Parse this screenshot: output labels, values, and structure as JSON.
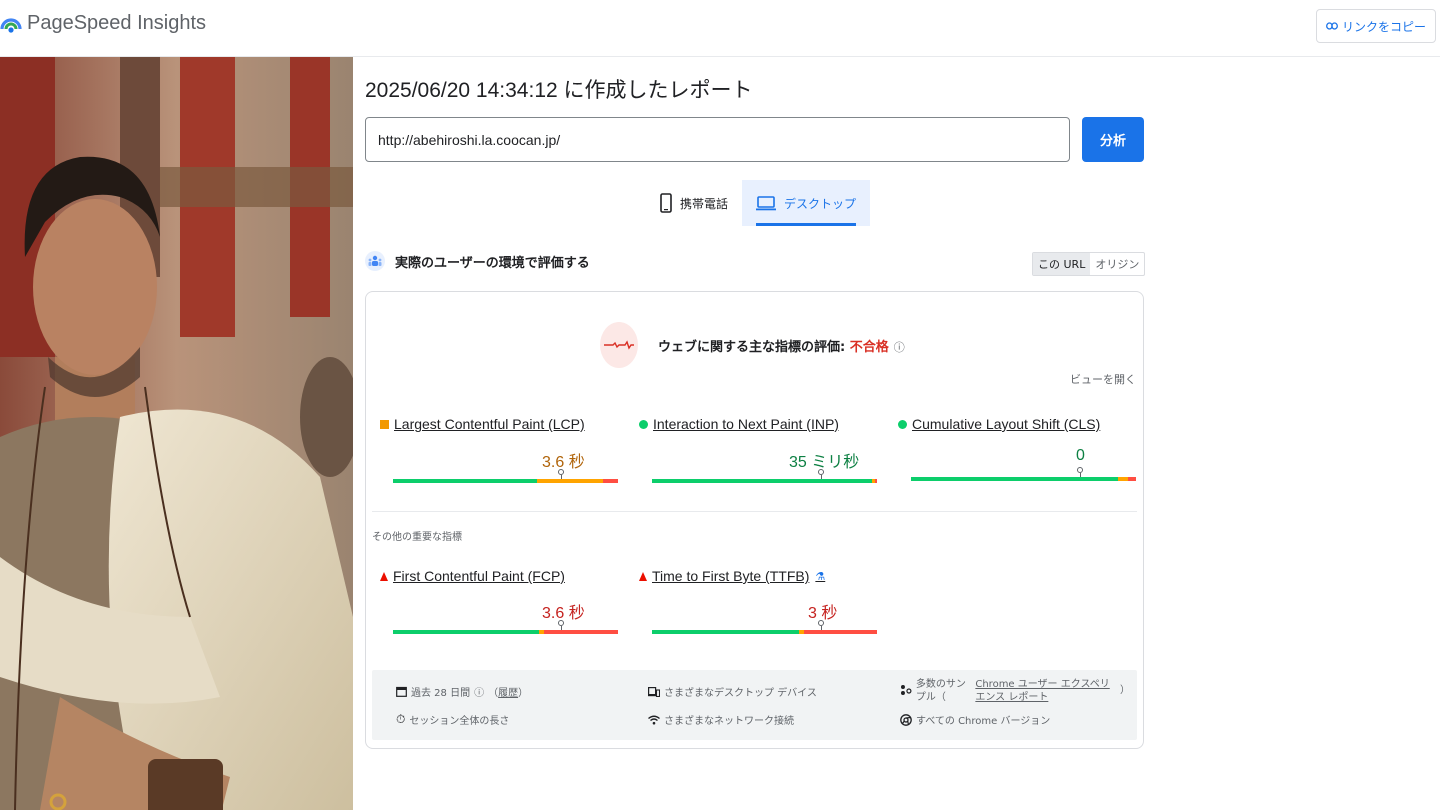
{
  "header": {
    "app_title": "PageSpeed Insights",
    "copy_link_label": "リンクをコピー"
  },
  "report": {
    "title": "2025/06/20 14:34:12 に作成したレポート",
    "url": "http://abehiroshi.la.coocan.jp/",
    "analyze_label": "分析"
  },
  "tabs": [
    {
      "label": "携帯電話",
      "active": false
    },
    {
      "label": "デスクトップ",
      "active": true
    }
  ],
  "field_data": {
    "section_title": "実際のユーザーの環境で評価する",
    "toggle": {
      "this_url": "この URL",
      "origin": "オリジン"
    },
    "assessment_label": "ウェブに関する主な指標の評価: ",
    "assessment_status": "不合格",
    "expand_label": "ビューを開く",
    "core_metrics": [
      {
        "name": "Largest Contentful Paint (LCP)",
        "value": "3.6 秒",
        "status": "needs-improvement",
        "color": "#b0640a"
      },
      {
        "name": "Interaction to Next Paint (INP)",
        "value": "35 ミリ秒",
        "status": "good",
        "color": "#0d8043"
      },
      {
        "name": "Cumulative Layout Shift (CLS)",
        "value": "0",
        "status": "good",
        "color": "#0d8043"
      }
    ],
    "other_label": "その他の重要な指標",
    "other_metrics": [
      {
        "name": "First Contentful Paint (FCP)",
        "value": "3.6 秒",
        "status": "poor",
        "color": "#c5221f"
      },
      {
        "name": "Time to First Byte (TTFB)",
        "value": "3 秒",
        "status": "poor",
        "color": "#c5221f"
      }
    ],
    "footer": {
      "period_prefix": "過去 28 日間",
      "period_link": "履歴",
      "session": "セッション全体の長さ",
      "devices": "さまざまなデスクトップ デバイス",
      "network": "さまざまなネットワーク接続",
      "samples_prefix": "多数のサンプル（",
      "samples_link": "Chrome ユーザー エクスペリエンス レポート",
      "samples_suffix": "）",
      "versions": "すべての Chrome バージョン"
    }
  },
  "colors": {
    "accent": "#1a73e8",
    "fail": "#d93025",
    "good": "#0cce6b",
    "average": "#ffa400",
    "poor": "#ff4e42"
  }
}
